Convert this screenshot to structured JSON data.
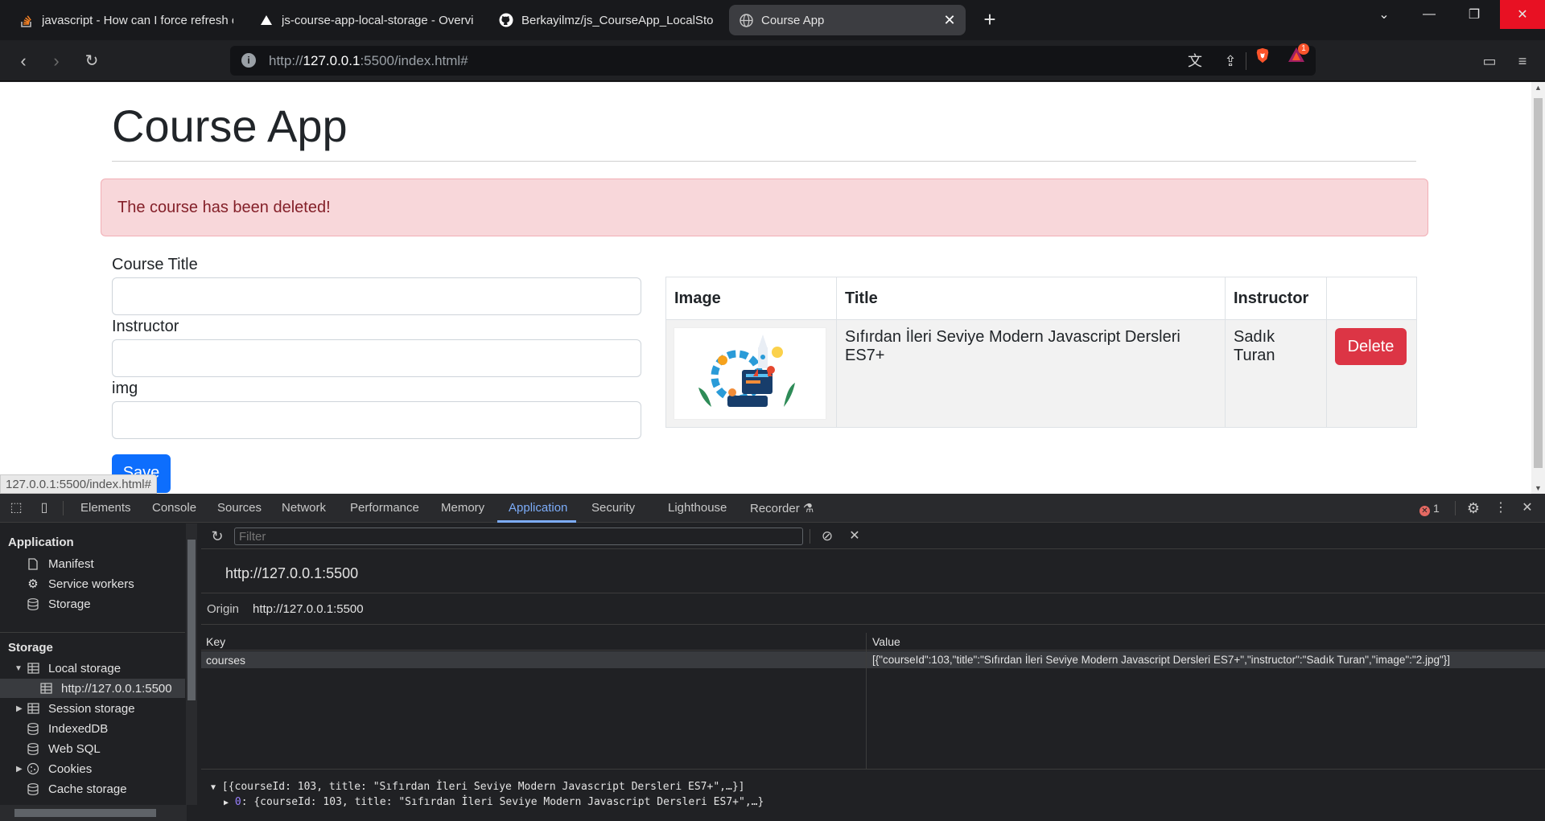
{
  "browser": {
    "tabs": [
      {
        "title": "javascript - How can I force refresh o",
        "icon": "stackoverflow-icon"
      },
      {
        "title": "js-course-app-local-storage - Overvi",
        "icon": "vercel-icon"
      },
      {
        "title": "Berkayilmz/js_CourseApp_LocalStora",
        "icon": "github-icon"
      },
      {
        "title": "Course App",
        "icon": "globe-icon",
        "active": true
      }
    ],
    "url_prefix": "http://",
    "url_host": "127.0.0.1",
    "url_suffix": ":5500/index.html#",
    "rewards_count": "1"
  },
  "page": {
    "title": "Course App",
    "alert": "The course has been deleted!",
    "form": {
      "title_label": "Course Title",
      "instructor_label": "Instructor",
      "img_label": "img",
      "save_label": "Save"
    },
    "table": {
      "headers": [
        "Image",
        "Title",
        "Instructor",
        ""
      ],
      "rows": [
        {
          "title": "Sıfırdan İleri Seviye Modern Javascript Dersleri ES7+",
          "instructor": "Sadık Turan",
          "action": "Delete"
        }
      ]
    },
    "status_url": "127.0.0.1:5500/index.html#"
  },
  "devtools": {
    "tabs": [
      "Elements",
      "Console",
      "Sources",
      "Network",
      "Performance",
      "Memory",
      "Application",
      "Security",
      "Lighthouse",
      "Recorder"
    ],
    "active_tab": "Application",
    "error_count": "1",
    "sidebar": {
      "application_head": "Application",
      "application_items": [
        "Manifest",
        "Service workers",
        "Storage"
      ],
      "storage_head": "Storage",
      "storage_items": [
        "Local storage",
        "http://127.0.0.1:5500",
        "Session storage",
        "IndexedDB",
        "Web SQL",
        "Cookies",
        "Cache storage"
      ]
    },
    "filter_placeholder": "Filter",
    "origin_title": "http://127.0.0.1:5500",
    "origin_label": "Origin",
    "origin_value": "http://127.0.0.1:5500",
    "kv": {
      "key_header": "Key",
      "value_header": "Value",
      "rows": [
        {
          "key": "courses",
          "value": "[{\"courseId\":103,\"title\":\"Sıfırdan İleri Seviye Modern Javascript Dersleri ES7+\",\"instructor\":\"Sadık Turan\",\"image\":\"2.jpg\"}]"
        }
      ]
    },
    "preview": {
      "line1": "[{courseId: 103, title: \"Sıfırdan İleri Seviye Modern Javascript Dersleri ES7+\",…}]",
      "line2_index": "0",
      "line2_rest": ": {courseId: 103, title: \"Sıfırdan İleri Seviye Modern Javascript Dersleri ES7+\",…}"
    }
  },
  "colors": {
    "accent": "#7cacf8",
    "danger": "#dc3545",
    "primary": "#0d6efd",
    "alert_bg": "#f8d7da"
  }
}
